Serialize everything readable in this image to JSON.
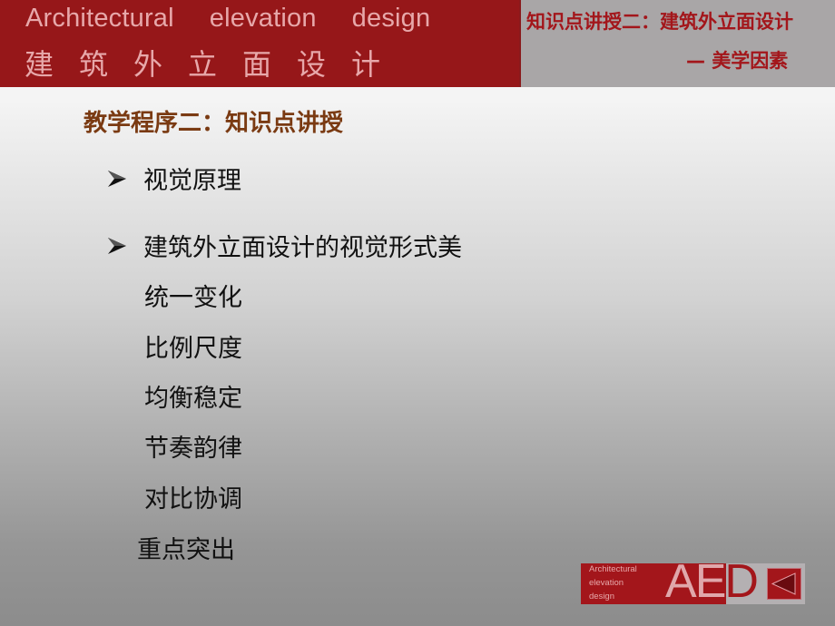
{
  "header": {
    "english_words": [
      "Architectural",
      "elevation",
      "design"
    ],
    "chinese_title": "建筑外立面设计",
    "topic_line1": "知识点讲授二：建筑外立面设计",
    "topic_line2": "— 美学因素"
  },
  "slide": {
    "title": "教学程序二：知识点讲授",
    "bullets": [
      {
        "icon": "arrowhead-bullet-icon",
        "text": "视觉原理"
      },
      {
        "icon": "arrowhead-bullet-icon",
        "text": "建筑外立面设计的视觉形式美"
      }
    ],
    "sub_items": [
      "统一变化",
      "比例尺度",
      "均衡稳定",
      "节奏韵律",
      "对比协调",
      "重点突出"
    ]
  },
  "footer_logo": {
    "small_lines": [
      "Architectural",
      "elevation",
      "design"
    ],
    "letters": [
      "A",
      "E",
      "D"
    ],
    "back_button_icon": "triangle-left-icon"
  },
  "colors": {
    "brand_red": "#961719",
    "header_text_pink": "#e7a8aa",
    "topic_red": "#a3161b",
    "title_brown": "#7a3a12",
    "header_gray": "#a9a6a7"
  }
}
